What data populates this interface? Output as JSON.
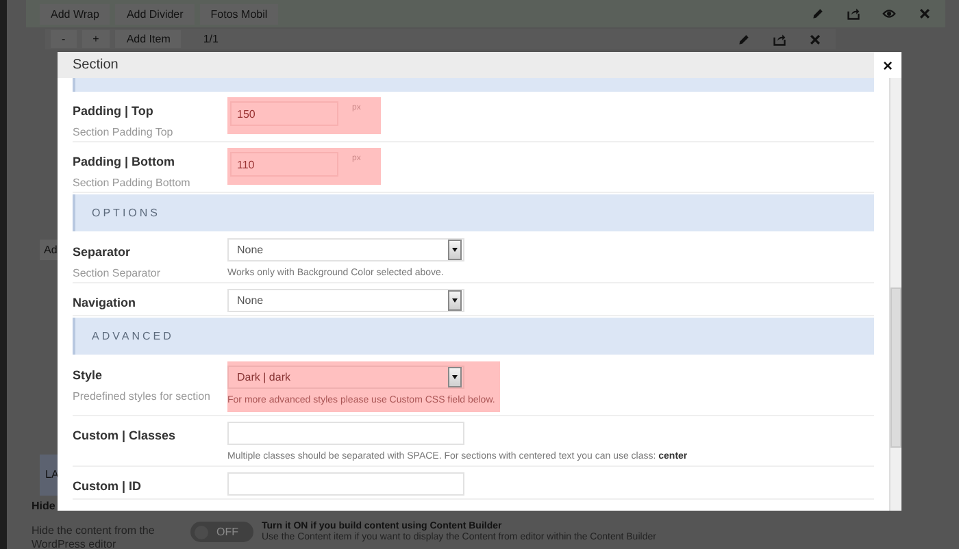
{
  "background": {
    "toolbar": {
      "buttons": [
        "Add Wrap",
        "Add Divider",
        "Fotos Mobil"
      ]
    },
    "item_bar": {
      "buttons": [
        "-",
        "+",
        "Add Item"
      ],
      "counter": "1/1"
    },
    "partial_button": "Ad",
    "partial_tab": "LA",
    "hide_option": {
      "label": "Hide",
      "description": "Hide the content from the WordPress editor",
      "toggle": {
        "label": "OFF",
        "on": false
      },
      "hint": "Turn it ON if you build content using Content Builder",
      "note": "Use the Content item if you want to display the Content from editor within the Content Builder"
    }
  },
  "modal": {
    "title": "Section",
    "close": "×",
    "fields": [
      {
        "kind": "number",
        "label": "Padding | Top",
        "description": "Section Padding Top",
        "value": "150",
        "unit": "px",
        "highlighted": true
      },
      {
        "kind": "number",
        "label": "Padding | Bottom",
        "description": "Section Padding Bottom",
        "value": "110",
        "unit": "px",
        "highlighted": true
      },
      {
        "kind": "header",
        "label": "OPTIONS"
      },
      {
        "kind": "select",
        "label": "Separator",
        "description": "Section Separator",
        "value": "None",
        "help": "Works only with Background Color selected above.",
        "highlighted": false
      },
      {
        "kind": "select",
        "label": "Navigation",
        "value": "None",
        "highlighted": false
      },
      {
        "kind": "header",
        "label": "ADVANCED"
      },
      {
        "kind": "select",
        "label": "Style",
        "description": "Predefined styles for section",
        "value": "Dark | dark",
        "help": "For more advanced styles please use Custom CSS field below.",
        "highlighted": true
      },
      {
        "kind": "input",
        "label": "Custom | Classes",
        "help": "Multiple classes should be separated with SPACE. For sections with centered text you can use class: **center**",
        "highlighted": false
      },
      {
        "kind": "input",
        "label": "Custom | ID",
        "highlighted": false
      }
    ]
  }
}
